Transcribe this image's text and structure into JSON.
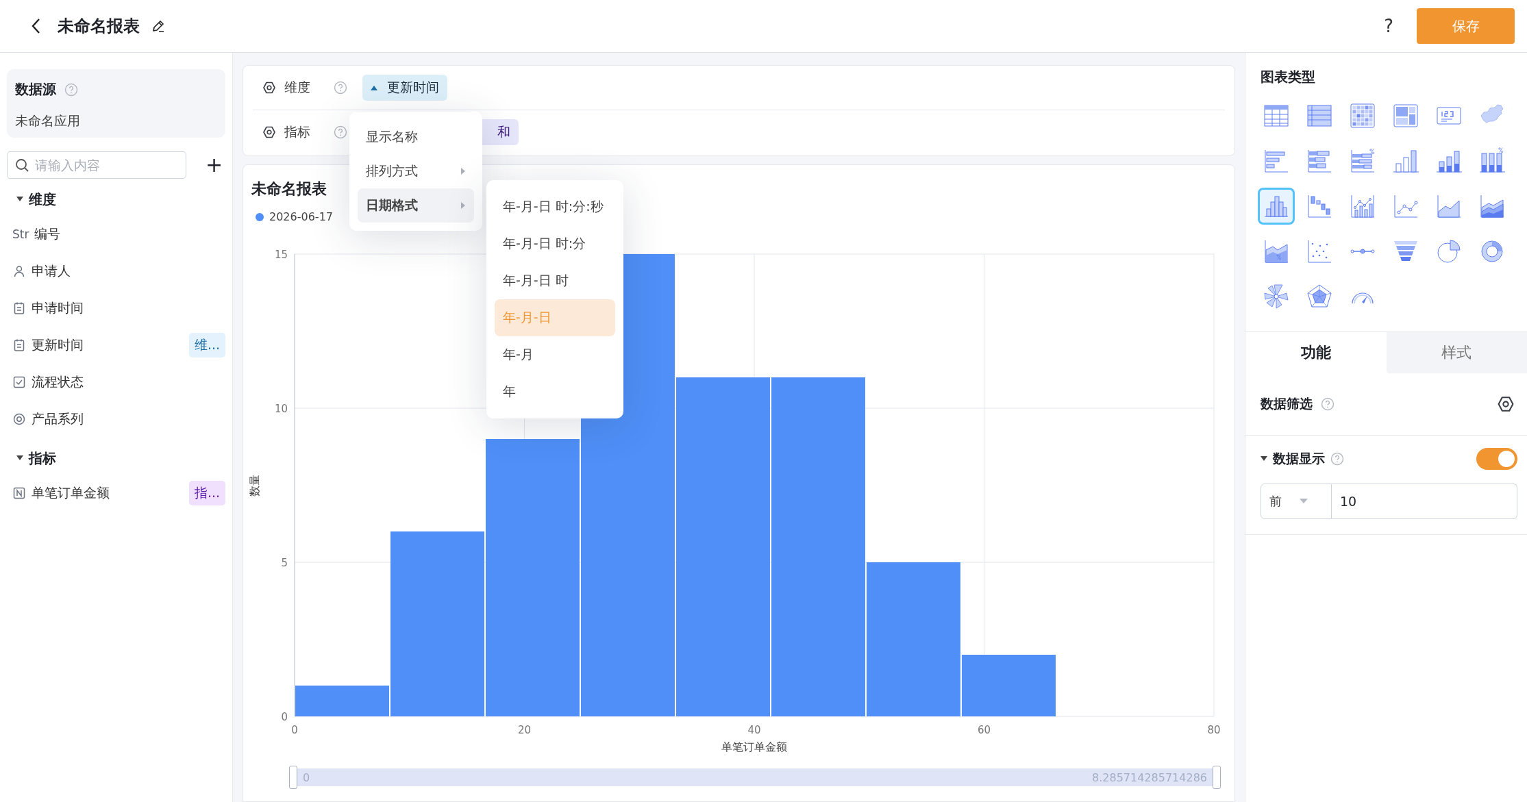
{
  "header": {
    "title": "未命名报表",
    "help": "?",
    "save": "保存"
  },
  "sidebar": {
    "datasource": {
      "title": "数据源",
      "app": "未命名应用"
    },
    "search": {
      "placeholder": "请输入内容"
    },
    "add": "+",
    "groups": [
      {
        "label": "维度",
        "expanded": true,
        "children": [
          {
            "kind": "text",
            "prefix": "Str",
            "label": "编号"
          },
          {
            "kind": "person",
            "label": "申请人"
          },
          {
            "kind": "date",
            "label": "申请时间"
          },
          {
            "kind": "date",
            "label": "更新时间",
            "tag": {
              "kind": "dimension",
              "text": "维..."
            }
          },
          {
            "kind": "check",
            "label": "流程状态"
          },
          {
            "kind": "option",
            "label": "产品系列"
          }
        ]
      },
      {
        "label": "指标",
        "expanded": true,
        "children": [
          {
            "kind": "number",
            "label": "单笔订单金额",
            "tag": {
              "kind": "metric",
              "text": "指..."
            }
          }
        ]
      }
    ]
  },
  "fields": [
    {
      "label": "维度",
      "chip": "更新时间",
      "kind": "dimension",
      "expanded": true
    },
    {
      "label": "指标",
      "chip": "和",
      "kind": "metric"
    }
  ],
  "menu": {
    "items": [
      {
        "label": "显示名称",
        "submenu": false,
        "selected": false
      },
      {
        "label": "排列方式",
        "submenu": true,
        "selected": false
      },
      {
        "label": "日期格式",
        "submenu": true,
        "selected": true
      }
    ]
  },
  "submenu": {
    "items": [
      {
        "label": "年-月-日 时:分:秒",
        "selected": false
      },
      {
        "label": "年-月-日 时:分",
        "selected": false
      },
      {
        "label": "年-月-日 时",
        "selected": false
      },
      {
        "label": "年-月-日",
        "selected": true
      },
      {
        "label": "年-月",
        "selected": false
      },
      {
        "label": "年",
        "selected": false
      }
    ]
  },
  "chart": {
    "title": "未命名报表",
    "chart_data": {
      "type": "bar",
      "xlabel": "单笔订单金额",
      "ylabel": "数量",
      "x": [
        4.143,
        12.429,
        20.714,
        29,
        37.286,
        45.571,
        53.857,
        62.143
      ],
      "series": [
        {
          "name": "2026-06-17",
          "color": "#4f8ff7",
          "values": [
            1,
            6,
            9,
            15,
            11,
            11,
            5,
            2
          ]
        }
      ],
      "xlim": [
        0,
        80
      ],
      "ylim": [
        0,
        15
      ],
      "xticks": [
        0,
        20,
        40,
        60,
        80
      ],
      "yticks": [
        0,
        5,
        10,
        15
      ],
      "grid": true
    },
    "zoom": {
      "start": "0",
      "end": "8.285714285714286"
    }
  },
  "panel": {
    "title": "图表类型",
    "chart_types": [
      {
        "kind": "table",
        "selected": false
      },
      {
        "kind": "list",
        "selected": false
      },
      {
        "kind": "heatmap",
        "selected": false
      },
      {
        "kind": "layout",
        "selected": false
      },
      {
        "kind": "kpi",
        "selected": false
      },
      {
        "kind": "map",
        "selected": false
      },
      {
        "kind": "hbar",
        "selected": false
      },
      {
        "kind": "hstack",
        "selected": false
      },
      {
        "kind": "hpercent",
        "selected": false
      },
      {
        "kind": "column",
        "selected": false
      },
      {
        "kind": "stack",
        "selected": false
      },
      {
        "kind": "percent",
        "selected": false
      },
      {
        "kind": "histogram",
        "selected": true
      },
      {
        "kind": "waterfall",
        "selected": false
      },
      {
        "kind": "combo",
        "selected": false
      },
      {
        "kind": "line",
        "selected": false
      },
      {
        "kind": "area",
        "selected": false
      },
      {
        "kind": "stackarea",
        "selected": false
      },
      {
        "kind": "percentarea",
        "selected": false
      },
      {
        "kind": "scatter",
        "selected": false
      },
      {
        "kind": "dotline",
        "selected": false
      },
      {
        "kind": "funnel",
        "selected": false
      },
      {
        "kind": "pie",
        "selected": false
      },
      {
        "kind": "donut",
        "selected": false
      },
      {
        "kind": "rose",
        "selected": false
      },
      {
        "kind": "radar",
        "selected": false
      },
      {
        "kind": "gauge",
        "selected": false
      }
    ],
    "tabs": [
      {
        "label": "功能",
        "selected": true
      },
      {
        "label": "样式",
        "selected": false
      }
    ],
    "filter": {
      "label": "数据筛选"
    },
    "display": {
      "label": "数据显示",
      "expanded": true,
      "on": true,
      "mode": "前",
      "value": "10"
    }
  }
}
